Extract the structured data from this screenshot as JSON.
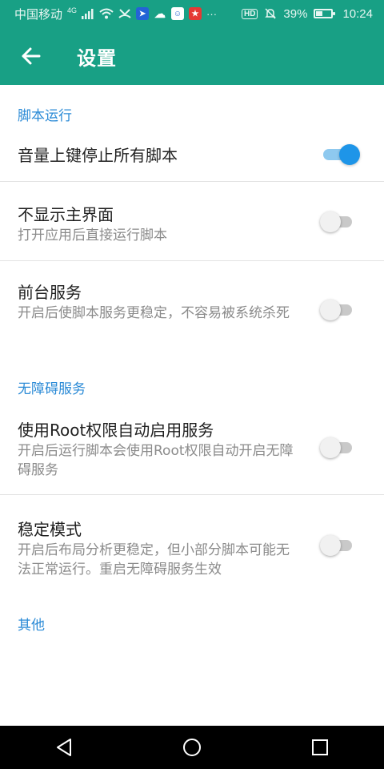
{
  "status_bar": {
    "carrier": "中国移动",
    "network": "4G",
    "battery_percent": "39%",
    "time": "10:24",
    "hd_badge": "HD",
    "overflow": "···",
    "icons": [
      "signal-icon",
      "wifi-icon",
      "missed-call-icon",
      "app-icon",
      "wechat-icon",
      "app-icon",
      "app-icon",
      "mute-icon",
      "battery-icon"
    ]
  },
  "app_bar": {
    "title": "设置",
    "back_icon": "arrow-left-icon",
    "color": "#18a085"
  },
  "sections": [
    {
      "header": "脚本运行",
      "items": [
        {
          "title": "音量上键停止所有脚本",
          "subtitle": "",
          "enabled": true
        }
      ]
    },
    {
      "header": "",
      "items": [
        {
          "title": "不显示主界面",
          "subtitle": "打开应用后直接运行脚本",
          "enabled": false
        },
        {
          "title": "前台服务",
          "subtitle": "开启后使脚本服务更稳定，不容易被系统杀死",
          "enabled": false
        }
      ]
    },
    {
      "header": "无障碍服务",
      "items": [
        {
          "title": "使用Root权限自动启用服务",
          "subtitle": "开启后运行脚本会使用Root权限自动开启无障碍服务",
          "enabled": false
        },
        {
          "title": "稳定模式",
          "subtitle": "开启后布局分析更稳定，但小部分脚本可能无法正常运行。重启无障碍服务生效",
          "enabled": false
        }
      ]
    },
    {
      "header": "其他",
      "items": []
    }
  ],
  "nav_bar": {
    "icons": [
      "back-triangle-icon",
      "home-circle-icon",
      "recents-square-icon"
    ]
  },
  "colors": {
    "accent": "#2a8ad6",
    "toggle_on": "#1e95e8",
    "toggle_off": "#f1f1f1"
  }
}
